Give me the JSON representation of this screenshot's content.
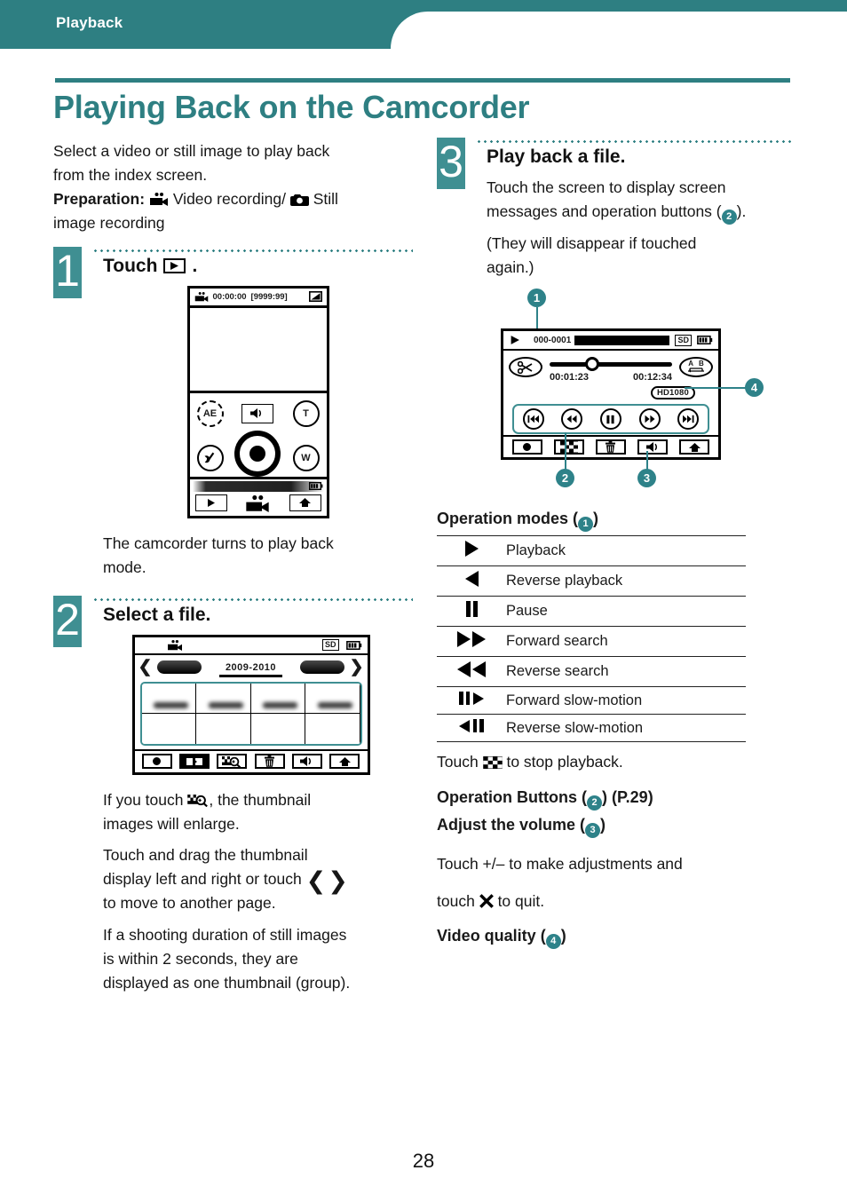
{
  "header": {
    "section_label": "Playback"
  },
  "page_title": "Playing Back on the Camcorder",
  "page_number": "28",
  "colors": {
    "teal": "#2e7f82",
    "badge_teal": "#2e8289",
    "accent_line": "#3f8f92"
  },
  "intro": {
    "line1": "Select a video or still image to play back",
    "line2": "from the index screen.",
    "prep_label": "Preparation:",
    "prep_video": "Video recording/",
    "prep_still": "Still",
    "prep_cont": "image recording",
    "icon_video": "video-camera-icon",
    "icon_still": "still-camera-icon"
  },
  "step1": {
    "number": "1",
    "heading": "Touch",
    "heading_icon": "play-button-icon",
    "heading_suffix": ".",
    "result_line1": "The camcorder turns to play back",
    "result_line2": "mode.",
    "screen": {
      "status_icon": "video-mode-icon",
      "timecode": "00:00:00",
      "remaining": "[9999:99]",
      "battery_icon": "battery-gradient-icon",
      "btn_ae": "AE",
      "btn_tele": "T",
      "btn_wide": "W",
      "btn_wrench": "wrench-icon",
      "btn_speaker": "speaker-icon",
      "btn_record": "record-dot-icon",
      "bottom_play": "play-icon",
      "bottom_video": "video-camera-icon",
      "bottom_home": "home-icon",
      "battery_small": "battery-icon"
    }
  },
  "step2": {
    "number": "2",
    "heading": "Select a file.",
    "screen": {
      "mode_icon": "video-camera-icon",
      "card_label": "SD",
      "battery_icon": "battery-icon",
      "prev_icon": "chevron-left-icon",
      "next_icon": "chevron-right-icon",
      "date_range": "2009-2010",
      "bottom_buttons": [
        "record-icon",
        "switch-media-icon",
        "zoom-thumbnail-icon",
        "trash-icon",
        "speaker-icon",
        "home-icon"
      ]
    },
    "notes": [
      {
        "pre": "If you touch",
        "icon": "zoom-thumbnail-icon",
        "post": ", the thumbnail"
      },
      {
        "text": "images will enlarge."
      },
      {
        "text": "Touch and drag the thumbnail"
      },
      {
        "pre2": "display left and right or touch",
        "icon2": "chevrons-icon"
      },
      {
        "text": "to move to another page."
      },
      {
        "text": "If a shooting duration of still images"
      },
      {
        "text": "is within 2 seconds, they are"
      },
      {
        "text": "displayed as one thumbnail (group)."
      }
    ]
  },
  "step3": {
    "number": "3",
    "heading": "Play back a file.",
    "text1a": "Touch the screen to display screen",
    "text1b": "messages and operation buttons (",
    "text1c": ").",
    "text2a": "(They will disappear if touched",
    "text2b": "again.)",
    "screen": {
      "play_icon": "play-icon",
      "file_number": "000-0001",
      "card_label": "SD",
      "battery_icon": "battery-icon",
      "scissors_icon": "scissors-icon",
      "ab_repeat_label_a": "A",
      "ab_repeat_label_b": "B",
      "time_elapsed": "00:01:23",
      "time_total": "00:12:34",
      "quality_tag": "HD1080",
      "op_buttons": [
        "skip-back-icon",
        "rewind-icon",
        "pause-icon",
        "fast-forward-icon",
        "skip-forward-icon"
      ],
      "bottom_buttons": [
        "record-icon",
        "stop-checker-icon",
        "trash-icon",
        "speaker-icon",
        "home-icon"
      ]
    },
    "callouts": {
      "c1": "1",
      "c2": "2",
      "c3": "3",
      "c4": "4"
    }
  },
  "operation_modes": {
    "title": "Operation modes (",
    "title_badge": "1",
    "title_close": ")",
    "rows": [
      {
        "icon": "play-icon",
        "label": "Playback"
      },
      {
        "icon": "reverse-play-icon",
        "label": "Reverse playback"
      },
      {
        "icon": "pause-icon",
        "label": "Pause"
      },
      {
        "icon": "fast-forward-icon",
        "label": "Forward search"
      },
      {
        "icon": "rewind-icon",
        "label": "Reverse search"
      },
      {
        "icon": "forward-slow-icon",
        "label": "Forward slow-motion"
      },
      {
        "icon": "reverse-slow-icon",
        "label": "Reverse slow-motion"
      }
    ],
    "stop_note_pre": "Touch",
    "stop_note_icon": "stop-checker-icon",
    "stop_note_post": "to stop playback."
  },
  "sections": {
    "op_buttons_title_a": "Operation Buttons (",
    "op_buttons_badge": "2",
    "op_buttons_title_b": ") (P.29)",
    "volume_title_a": "Adjust the volume (",
    "volume_badge": "3",
    "volume_title_b": ")",
    "volume_text_a": "Touch +/– to make adjustments and",
    "volume_text_b": "touch",
    "volume_icon": "close-x-icon",
    "volume_text_c": "to quit.",
    "quality_title_a": "Video quality (",
    "quality_badge": "4",
    "quality_title_b": ")"
  }
}
